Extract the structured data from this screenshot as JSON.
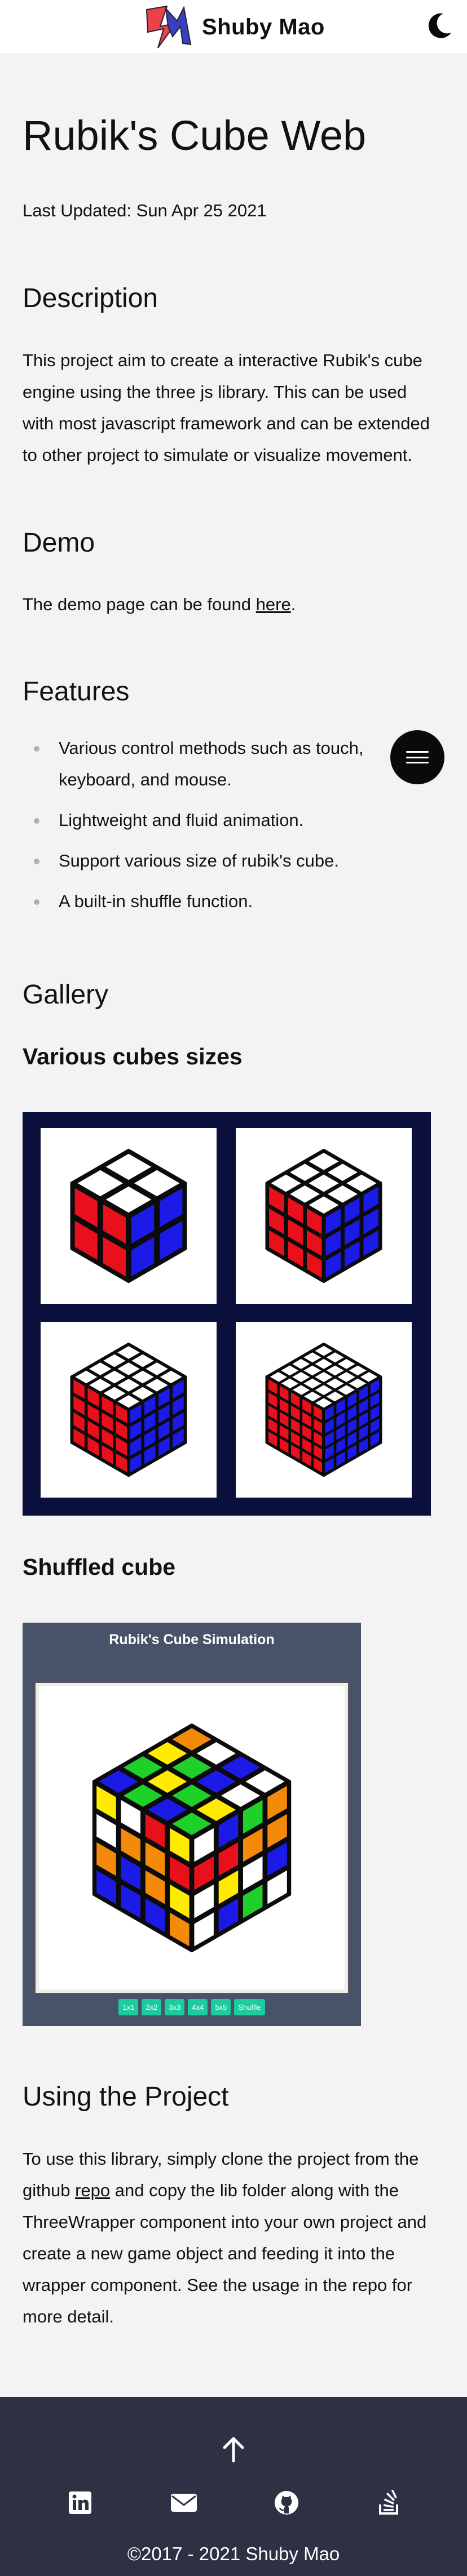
{
  "header": {
    "brand_name": "Shuby Mao",
    "logo_icon": "sm-monogram-logo",
    "theme_icon": "crescent-moon-icon"
  },
  "article": {
    "title": "Rubik's Cube Web",
    "last_updated": "Last Updated: Sun Apr 25 2021",
    "description": {
      "heading": "Description",
      "text": "This project aim to create a interactive Rubik's cube engine using the three js library. This can be used with most javascript framework and can be extended to other project to simulate or visualize movement."
    },
    "demo": {
      "heading": "Demo",
      "text_before": "The demo page can be found ",
      "link_text": "here",
      "text_after": "."
    },
    "features": {
      "heading": "Features",
      "items": [
        "Various control methods such as touch, keyboard, and mouse.",
        "Lightweight and fluid animation.",
        "Support various size of rubik's cube.",
        "A built-in shuffle function."
      ]
    },
    "gallery": {
      "heading": "Gallery",
      "sizes_heading": "Various cubes sizes",
      "shuffled_heading": "Shuffled cube",
      "cube_sizes": [
        2,
        3,
        4,
        5
      ]
    },
    "simulation": {
      "title": "Rubik's Cube Simulation",
      "buttons": [
        "1x1",
        "2x2",
        "3x3",
        "4x4",
        "5x5",
        "Shuffle"
      ]
    },
    "usage": {
      "heading": "Using the Project",
      "text_before": "To use this library, simply clone the project from the github ",
      "link_text": "repo",
      "text_after": " and copy the lib folder along with the ThreeWrapper component into your own project and create a new game object and feeding it into the wrapper component. See the usage in the repo for more detail."
    }
  },
  "footer": {
    "up_icon": "arrow-up-icon",
    "social_icons": [
      "linkedin-icon",
      "mail-icon",
      "github-icon",
      "stackoverflow-icon"
    ],
    "copyright": "©2017 - 2021 Shuby Mao"
  },
  "colors": {
    "footer_bg": "#2e3144",
    "gallery_bg": "#0a0f3c",
    "sim_bg": "#485269",
    "sim_button": "#1ccc9e",
    "cube_red": "#e8101a",
    "cube_blue": "#1c1ae6",
    "cube_white": "#ffffff"
  }
}
